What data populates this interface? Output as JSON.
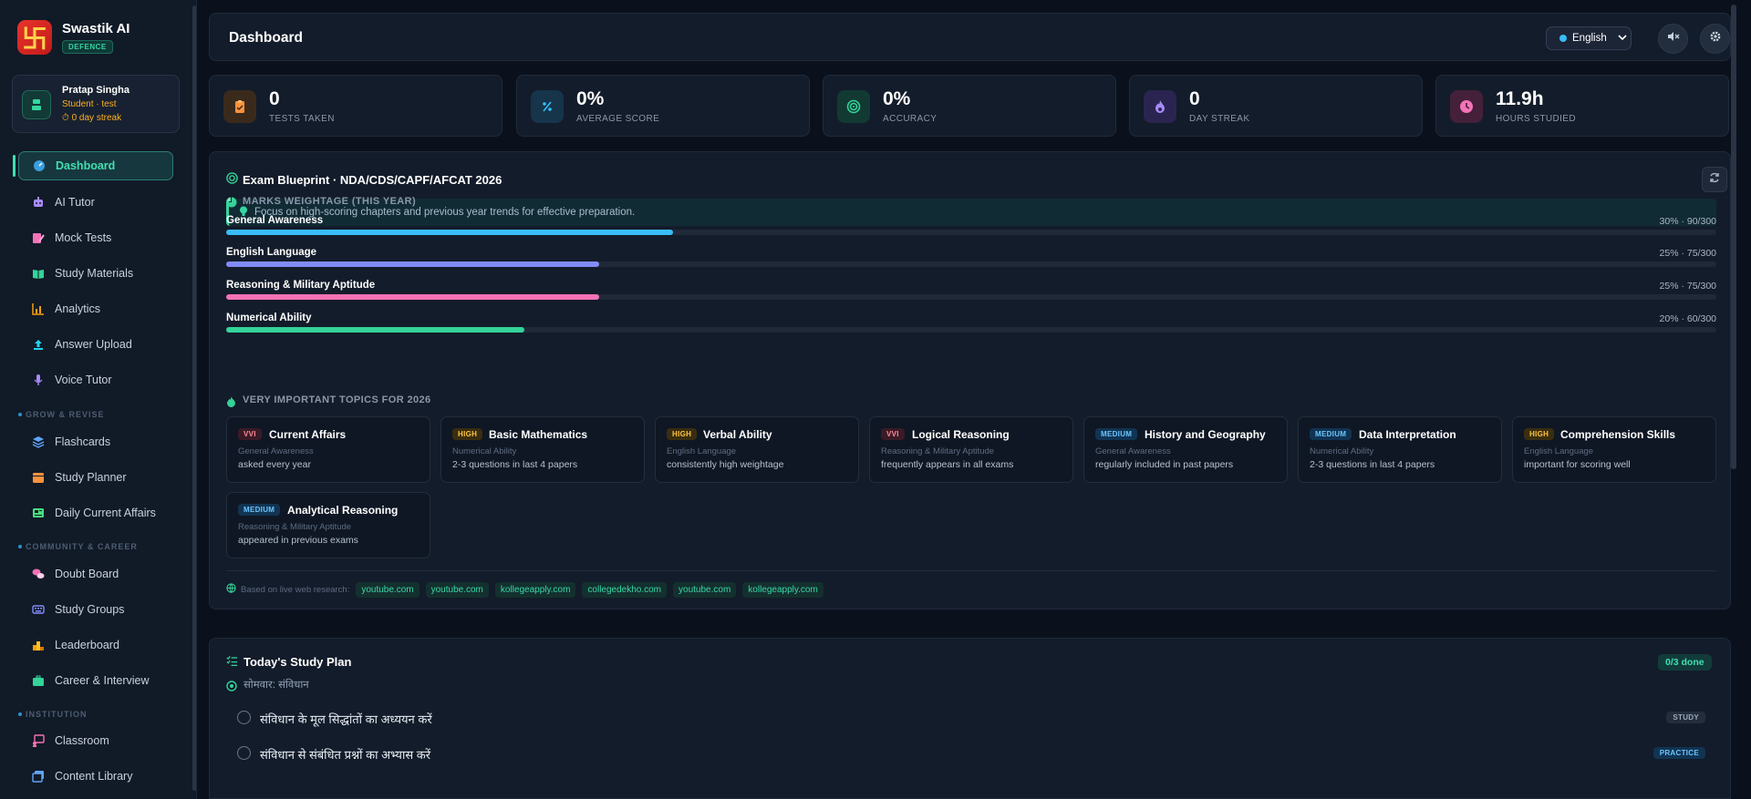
{
  "brand": {
    "name": "Swastik AI",
    "badge": "DEFENCE",
    "logo_glyph": "卐"
  },
  "user": {
    "name": "Pratap Singha",
    "role": "Student · test",
    "streak": "0 day streak"
  },
  "nav": {
    "dashboard": "Dashboard",
    "ai_tutor": "AI Tutor",
    "mock_tests": "Mock Tests",
    "study_materials": "Study Materials",
    "analytics": "Analytics",
    "answer_upload": "Answer Upload",
    "voice_tutor": "Voice Tutor",
    "section_grow": "GROW & REVISE",
    "flashcards": "Flashcards",
    "study_planner": "Study Planner",
    "daily_current_affairs": "Daily Current Affairs",
    "section_community": "COMMUNITY & CAREER",
    "doubt_board": "Doubt Board",
    "study_groups": "Study Groups",
    "leaderboard": "Leaderboard",
    "career_interview": "Career & Interview",
    "section_institution": "INSTITUTION",
    "classroom": "Classroom",
    "content_library": "Content Library"
  },
  "header": {
    "title": "Dashboard",
    "language": "English"
  },
  "stats": [
    {
      "value": "0",
      "label": "TESTS TAKEN"
    },
    {
      "value": "0%",
      "label": "AVERAGE SCORE"
    },
    {
      "value": "0%",
      "label": "ACCURACY"
    },
    {
      "value": "0",
      "label": "DAY STREAK"
    },
    {
      "value": "11.9h",
      "label": "HOURS STUDIED"
    }
  ],
  "blueprint": {
    "title": "Exam Blueprint · NDA/CDS/CAPF/AFCAT 2026",
    "tip": "Focus on high-scoring chapters and previous year trends for effective preparation.",
    "weightage_heading": "MARKS WEIGHTAGE (THIS YEAR)",
    "weightage": [
      {
        "name": "General Awareness",
        "value": "30% · 90/300",
        "percent": 30,
        "color": "#38bdf8"
      },
      {
        "name": "English Language",
        "value": "25% · 75/300",
        "percent": 25,
        "color": "#818cf8"
      },
      {
        "name": "Reasoning & Military Aptitude",
        "value": "25% · 75/300",
        "percent": 25,
        "color": "#f472b6"
      },
      {
        "name": "Numerical Ability",
        "value": "20% · 60/300",
        "percent": 20,
        "color": "#34d399"
      }
    ],
    "topics_heading": "VERY IMPORTANT TOPICS FOR 2026",
    "topics": [
      {
        "badge": "VVI",
        "title": "Current Affairs",
        "subject": "General Awareness",
        "note": "asked every year"
      },
      {
        "badge": "HIGH",
        "title": "Basic Mathematics",
        "subject": "Numerical Ability",
        "note": "2-3 questions in last 4 papers"
      },
      {
        "badge": "HIGH",
        "title": "Verbal Ability",
        "subject": "English Language",
        "note": "consistently high weightage"
      },
      {
        "badge": "VVI",
        "title": "Logical Reasoning",
        "subject": "Reasoning & Military Aptitude",
        "note": "frequently appears in all exams"
      },
      {
        "badge": "MEDIUM",
        "title": "History and Geography",
        "subject": "General Awareness",
        "note": "regularly included in past papers"
      },
      {
        "badge": "MEDIUM",
        "title": "Data Interpretation",
        "subject": "Numerical Ability",
        "note": "2-3 questions in last 4 papers"
      },
      {
        "badge": "HIGH",
        "title": "Comprehension Skills",
        "subject": "English Language",
        "note": "important for scoring well"
      },
      {
        "badge": "MEDIUM",
        "title": "Analytical Reasoning",
        "subject": "Reasoning & Military Aptitude",
        "note": "appeared in previous exams"
      }
    ],
    "sources_label": "Based on live web research:",
    "sources": [
      "youtube.com",
      "youtube.com",
      "kollegeapply.com",
      "collegedekho.com",
      "youtube.com",
      "kollegeapply.com"
    ]
  },
  "plan": {
    "title": "Today's Study Plan",
    "done": "0/3 done",
    "day": "सोमवार: संविधान",
    "tasks": [
      {
        "text": "संविधान के मूल सिद्धांतों का अध्ययन करें",
        "tag": "STUDY"
      },
      {
        "text": "संविधान से संबंधित प्रश्नों का अभ्यास करें",
        "tag": "PRACTICE"
      }
    ]
  }
}
